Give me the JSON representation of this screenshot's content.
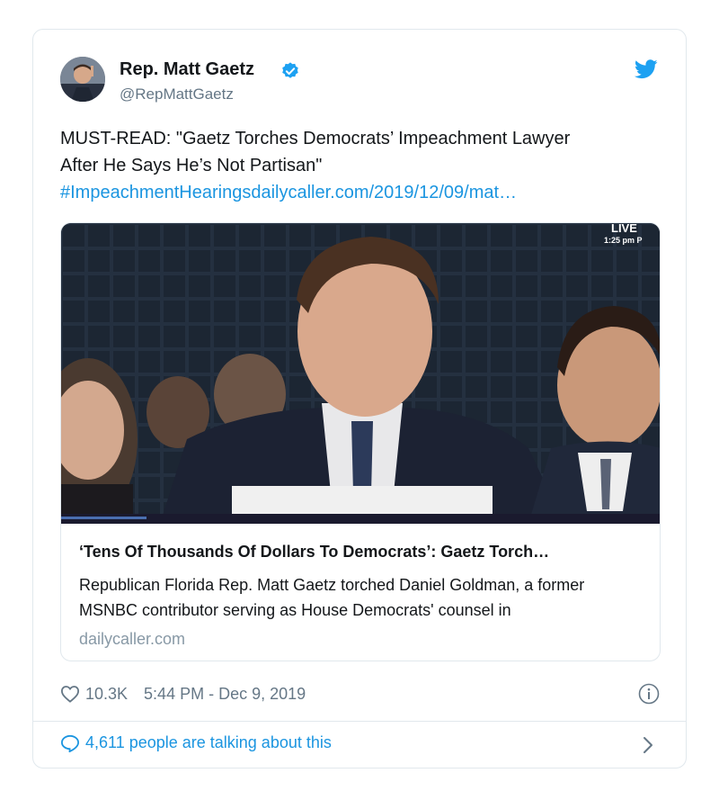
{
  "author": {
    "name": "Rep. Matt Gaetz",
    "handle": "@RepMattGaetz",
    "verified": true
  },
  "tweet": {
    "text_line1": "MUST-READ: \"Gaetz Torches Democrats’ Impeachment Lawyer",
    "text_line2": "After He Says He’s Not Partisan\"",
    "link_text": "#ImpeachmentHearingsdailycaller.com/2019/12/09/mat…"
  },
  "card": {
    "image_overlay": "LIVE",
    "image_time": "1:25 pm P",
    "title": "‘Tens Of Thousands Of Dollars To Democrats’: Gaetz Torch…",
    "description": "Republican Florida Rep. Matt Gaetz torched Daniel Goldman, a former MSNBC contributor serving as House Democrats' counsel in",
    "domain": "dailycaller.com"
  },
  "footer": {
    "likes": "10.3K",
    "timestamp": "5:44 PM - Dec 9, 2019",
    "talking": "4,611 people are talking about this"
  },
  "icons": {
    "brand": "twitter-bird-icon",
    "like": "heart-icon",
    "info": "info-icon",
    "reply": "speech-bubble-icon",
    "chevron": "chevron-right-icon"
  },
  "colors": {
    "link": "#1b95e0",
    "verified": "#1da1f2",
    "muted": "#657786",
    "border": "#e1e8ed"
  }
}
